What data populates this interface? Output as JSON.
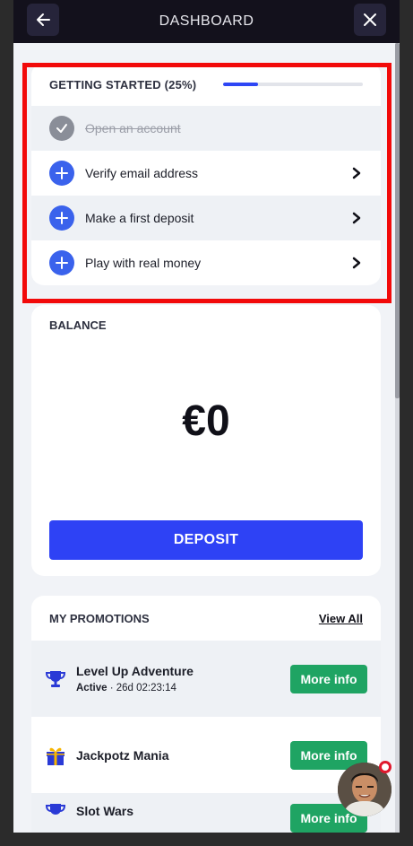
{
  "header": {
    "title": "DASHBOARD"
  },
  "getting_started": {
    "title": "GETTING STARTED (25%)",
    "progress_percent": 25,
    "tasks": [
      {
        "label": "Open an account",
        "done": true
      },
      {
        "label": "Verify email address",
        "done": false
      },
      {
        "label": "Make a first deposit",
        "done": false
      },
      {
        "label": "Play with real money",
        "done": false
      }
    ]
  },
  "balance": {
    "title": "BALANCE",
    "amount": "€0",
    "deposit_label": "DEPOSIT"
  },
  "promotions": {
    "title": "MY PROMOTIONS",
    "view_all": "View All",
    "items": [
      {
        "name": "Level Up Adventure",
        "status": "Active",
        "timer": " · 26d 02:23:14",
        "button": "More info",
        "icon": "trophy-icon"
      },
      {
        "name": "Jackpotz Mania",
        "button": "More info",
        "icon": "gift-icon"
      },
      {
        "name": "Slot Wars",
        "button": "More info",
        "icon": "trophy-icon"
      }
    ]
  },
  "colors": {
    "accent": "#2e42f5",
    "success": "#1fa463",
    "highlight": "#f20a0a"
  }
}
